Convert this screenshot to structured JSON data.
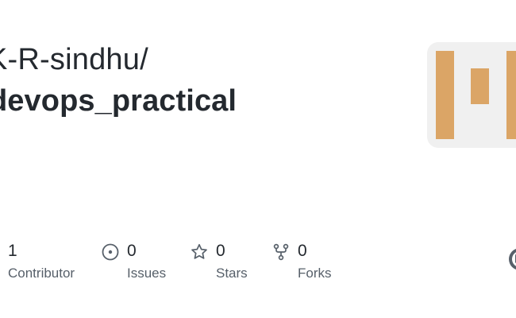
{
  "repo_card": {
    "owner": "K-R-sindhu/",
    "name": "devops_practical",
    "identicon_color": "#dba566",
    "identicon_bg": "#f0f0f0"
  },
  "stats": {
    "contributors": {
      "count": "1",
      "label": "Contributor",
      "icon": "people-icon"
    },
    "issues": {
      "count": "0",
      "label": "Issues",
      "icon": "issue-opened-icon"
    },
    "stars": {
      "count": "0",
      "label": "Stars",
      "icon": "star-icon"
    },
    "forks": {
      "count": "0",
      "label": "Forks",
      "icon": "repo-forked-icon"
    }
  },
  "github_logo": {
    "icon": "github-mark-icon"
  },
  "colors": {
    "text_primary": "#24292f",
    "text_secondary": "#57606a",
    "icon": "#57606a"
  }
}
